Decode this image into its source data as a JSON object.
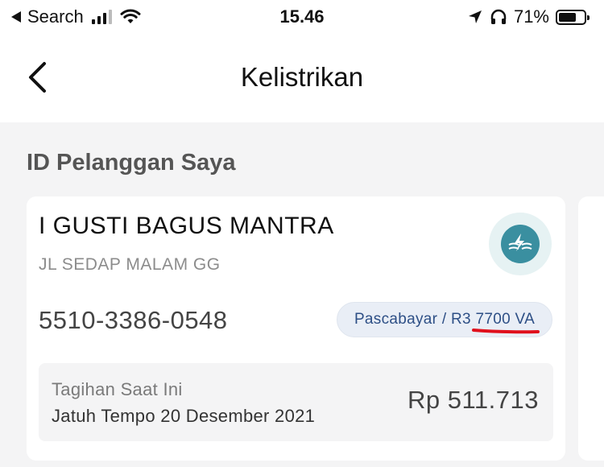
{
  "status_bar": {
    "back_app": "Search",
    "time": "15.46",
    "battery_percent": "71%",
    "battery_level": 0.71
  },
  "header": {
    "title": "Kelistrikan"
  },
  "section": {
    "title": "ID Pelanggan Saya"
  },
  "customer_card": {
    "name": "I GUSTI BAGUS MANTRA",
    "address": "JL SEDAP MALAM GG",
    "customer_id": "5510-3386-0548",
    "tariff": "Pascabayar / R3 7700 VA",
    "bill": {
      "label": "Tagihan Saat Ini",
      "due": "Jatuh Tempo 20 Desember 2021",
      "amount": "Rp 511.713"
    }
  },
  "colors": {
    "logo": "#3a8fa0",
    "tariff_text": "#2d4f86",
    "annotation": "#e0101c"
  }
}
